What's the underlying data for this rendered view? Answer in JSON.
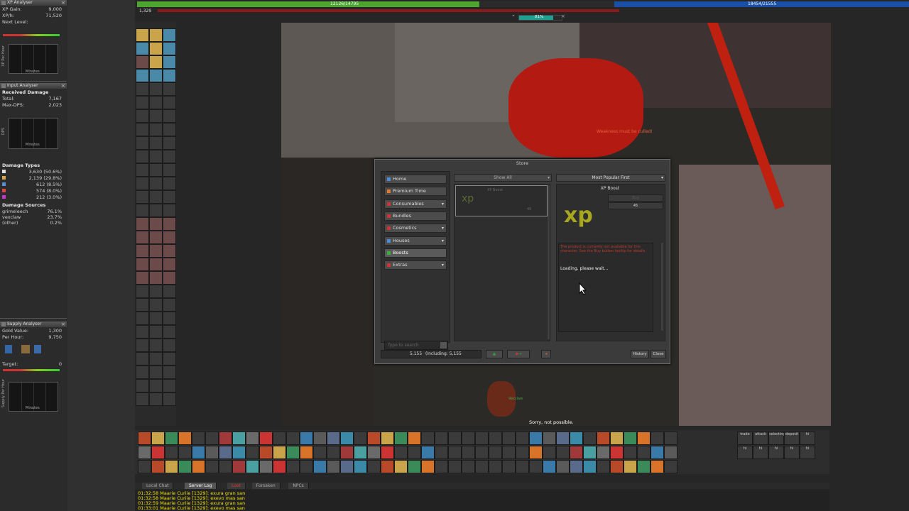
{
  "xp_analyser": {
    "title": "XP Analyser",
    "xp_gain_label": "XP Gain:",
    "xp_gain_value": "9,000",
    "xp_h_label": "XP/h:",
    "xp_h_value": "71,520",
    "next_level_label": "Next Level:",
    "graph_ylabel": "XP Per Hour",
    "graph_xlabel": "Minutes"
  },
  "input_analyser": {
    "title": "Input Analyser",
    "received_damage_label": "Received Damage",
    "total_label": "Total:",
    "total_value": "7,167",
    "max_dps_label": "Max-DPS:",
    "max_dps_value": "2,023",
    "graph_ylabel": "DPS",
    "graph_xlabel": "Minutes",
    "damage_types_label": "Damage Types",
    "damage_types": [
      {
        "value": "3,630 (50.6%)",
        "color": "#e0e0e0"
      },
      {
        "value": "2,139 (29.8%)",
        "color": "#d7a84a"
      },
      {
        "value": "612 (8.5%)",
        "color": "#5a8fd6"
      },
      {
        "value": "574 (8.0%)",
        "color": "#d44"
      },
      {
        "value": "212 (3.0%)",
        "color": "#c3c"
      }
    ],
    "damage_sources_label": "Damage Sources",
    "damage_sources": [
      {
        "name": "grimeleech",
        "value": "76.1%"
      },
      {
        "name": "vexclaw",
        "value": "23.7%"
      },
      {
        "name": "(other)",
        "value": "0.2%"
      }
    ]
  },
  "supply_analyser": {
    "title": "Supply Analyser",
    "gold_value_label": "Gold Value:",
    "gold_value": "1,300",
    "per_hour_label": "Per Hour:",
    "per_hour_value": "9,750",
    "target_label": "Target:",
    "target_value": "0",
    "graph_ylabel": "Supply Per Hour",
    "graph_xlabel": "Minutes"
  },
  "status": {
    "health_text": "12126/14795",
    "health_fraction": 0.82,
    "mana_text": "18454/21555",
    "level_text": "1,329",
    "exp_percent": "81%"
  },
  "store": {
    "title": "Store",
    "menu": [
      {
        "label": "Home",
        "icon_color": "#4a8ad6",
        "has_arrow": false
      },
      {
        "label": "Premium Time",
        "icon_color": "#e07a2a",
        "has_arrow": false
      },
      {
        "label": "Consumables",
        "icon_color": "#c33",
        "has_arrow": true
      },
      {
        "label": "Bundles",
        "icon_color": "#c33",
        "has_arrow": false
      },
      {
        "label": "Cosmetics",
        "icon_color": "#c33",
        "has_arrow": true
      },
      {
        "label": "Houses",
        "icon_color": "#4a8ad6",
        "has_arrow": true
      },
      {
        "label": "Boosts",
        "icon_color": "#3ab03a",
        "has_arrow": false,
        "selected": true
      },
      {
        "label": "Extras",
        "icon_color": "#c33",
        "has_arrow": true
      }
    ],
    "search_placeholder": "Type to search",
    "filter_dropdown": "Show All",
    "sort_dropdown": "Most Popular First",
    "product_list_item": "XP Boost",
    "product_list_price": "45",
    "detail_title": "XP Boost",
    "detail_buy": "Buy",
    "detail_price": "45",
    "product_icon_text": "xp",
    "unavailable_note": "The product is currently not available for this character. See the Buy button tooltip for details.",
    "loading_text": "Loading, please wait...",
    "coins_text": "5,155",
    "coins_including": "(Including: 5,155",
    "history_button": "History",
    "close_button": "Close"
  },
  "world": {
    "creature_text": "Weakness must be culled!",
    "creature_name": "Vexclaw",
    "status_message": "Sorry, not possible."
  },
  "chat": {
    "tabs": [
      "Local Chat",
      "Server Log",
      "Loot",
      "Forsaken",
      "NPCs"
    ],
    "lines": [
      "01:32:58 Maarie Curiie [1329]: exura gran san",
      "01:32:58 Maarie Curiie [1329]: exevo mas san",
      "01:32:59 Maarie Curiie [1329]: exura gran san",
      "01:33:01 Maarie Curiie [1329]: exevo mas san"
    ]
  },
  "hotbar_text_buttons": [
    "trade",
    "attack",
    "selecting",
    "deposit",
    "hi",
    "hi",
    "hi",
    "hi",
    "hi",
    "hi"
  ]
}
